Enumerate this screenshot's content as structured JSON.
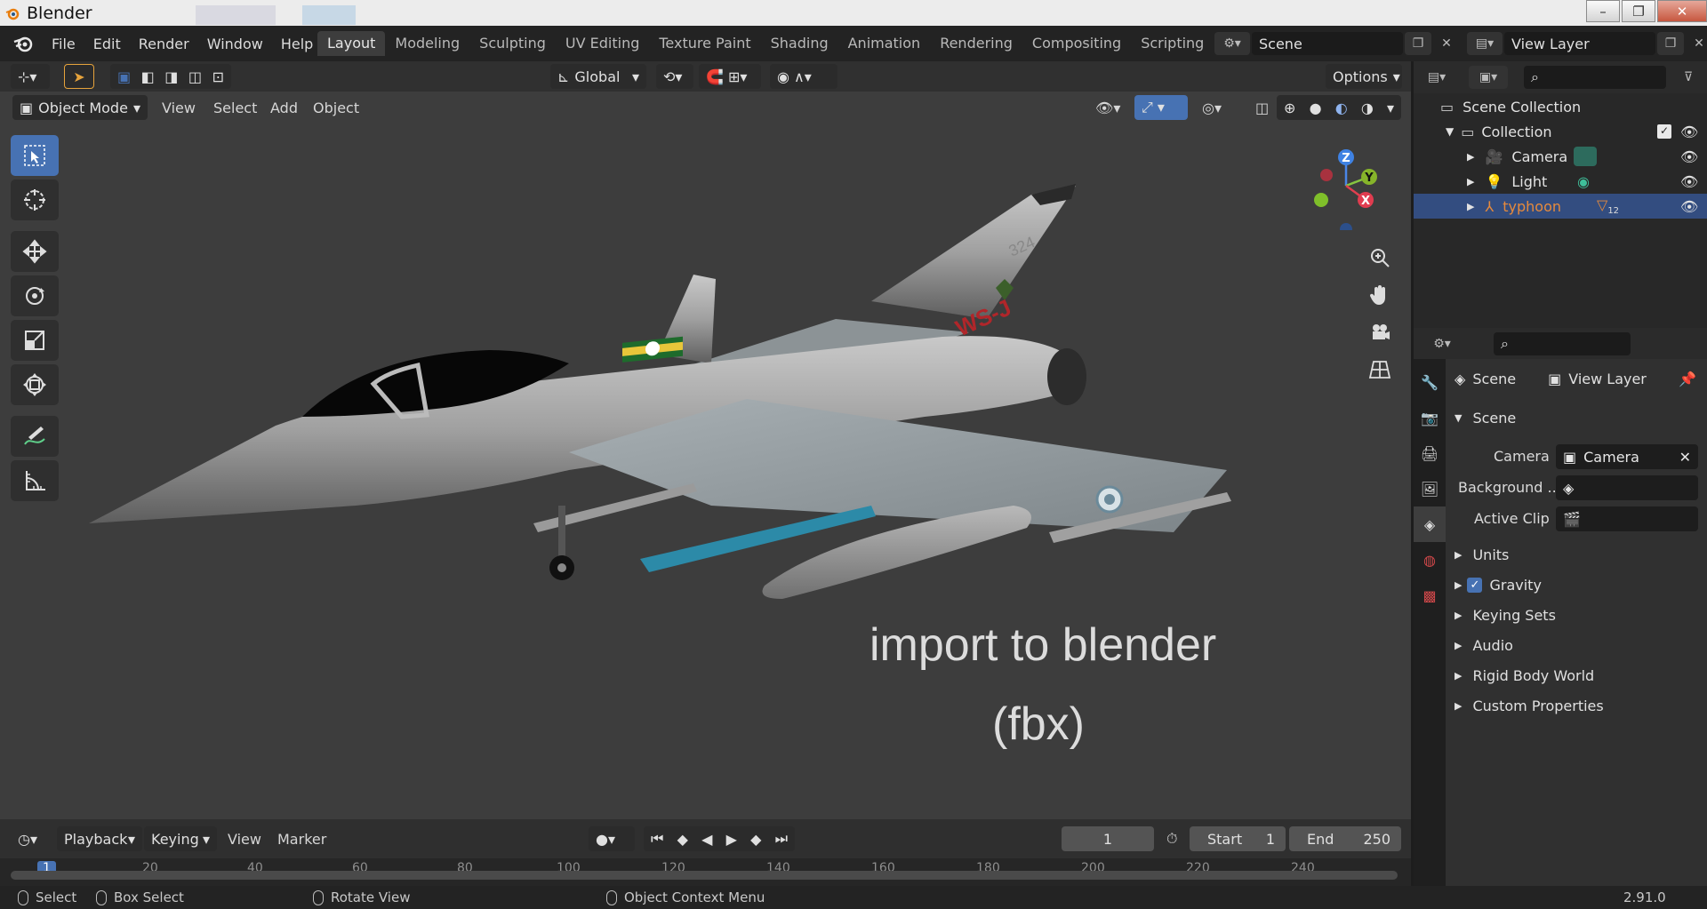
{
  "window": {
    "title": "Blender",
    "buttons": {
      "minimize": "–",
      "restore": "❐",
      "close": "✕"
    }
  },
  "menu": [
    "File",
    "Edit",
    "Render",
    "Window",
    "Help"
  ],
  "workspace_tabs": [
    "Layout",
    "Modeling",
    "Sculpting",
    "UV Editing",
    "Texture Paint",
    "Shading",
    "Animation",
    "Rendering",
    "Compositing",
    "Scripting"
  ],
  "workspace_active": "Layout",
  "scene_selector": {
    "value": "Scene"
  },
  "view_layer_selector": {
    "value": "View Layer"
  },
  "viewport": {
    "transform_orientation": "Global",
    "options_label": "Options",
    "mode": "Object Mode",
    "header_menus": [
      "View",
      "Select",
      "Add",
      "Object"
    ],
    "gizmo_axes": {
      "z": "Z",
      "y": "Y",
      "x": "X"
    },
    "overlay_title": "import to blender",
    "overlay_subtitle": "(fbx)",
    "aircraft_marking": "WS-J",
    "aircraft_tail_number": "324"
  },
  "outliner": {
    "root": "Scene Collection",
    "collection": "Collection",
    "items": [
      {
        "label": "Camera",
        "icon": "camera-icon"
      },
      {
        "label": "Light",
        "icon": "light-icon"
      },
      {
        "label": "typhoon",
        "icon": "empty-icon",
        "badge": "12",
        "selected": true
      }
    ]
  },
  "properties": {
    "breadcrumb_scene": "Scene",
    "breadcrumb_view_layer": "View Layer",
    "panel_title": "Scene",
    "fields": [
      {
        "label": "Camera",
        "value": "Camera"
      },
      {
        "label": "Background ...",
        "value": ""
      },
      {
        "label": "Active Clip",
        "value": ""
      }
    ],
    "sections": [
      "Units",
      "Gravity",
      "Keying Sets",
      "Audio",
      "Rigid Body World",
      "Custom Properties"
    ],
    "gravity_checked": true
  },
  "timeline": {
    "menus": [
      "Playback",
      "Keying",
      "View",
      "Marker"
    ],
    "current_frame": "1",
    "start_label": "Start",
    "start_value": "1",
    "end_label": "End",
    "end_value": "250",
    "ruler_ticks": [
      "1",
      "20",
      "40",
      "60",
      "80",
      "100",
      "120",
      "140",
      "160",
      "180",
      "200",
      "220",
      "240"
    ]
  },
  "statusbar": {
    "select": "Select",
    "box_select": "Box Select",
    "rotate_view": "Rotate View",
    "context_menu": "Object Context Menu",
    "version": "2.91.0"
  },
  "colors": {
    "accent_blue": "#4772b3",
    "selected_row": "#334d80",
    "typhoon_orange": "#e68a3c",
    "viewport_bg": "#3d3d3d"
  }
}
